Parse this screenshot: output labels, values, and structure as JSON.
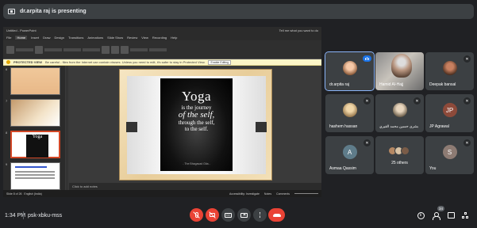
{
  "banner": {
    "presenter_text": "dr.arpita raj is presenting"
  },
  "presentation": {
    "window_title": "Untitled - PowerPoint",
    "ribbon_tabs": [
      "File",
      "Home",
      "Insert",
      "Draw",
      "Design",
      "Transitions",
      "Animations",
      "Slide Show",
      "Review",
      "View",
      "Recording",
      "Help"
    ],
    "tell_me": "Tell me what you want to do",
    "protected_view_label": "PROTECTED VIEW",
    "warning_text": "Be careful - files from the Internet can contain viruses. Unless you need to edit, it's safer to stay in Protected View.",
    "enable_button": "Enable Editing",
    "slide_numbers": [
      "6",
      "7",
      "8",
      "9"
    ],
    "slide": {
      "title": "Yoga",
      "line1": "is the journey",
      "line2": "of the self,",
      "line3": "through the self,",
      "line4": "to the self.",
      "attribution": "- The Bhagavad Gita -"
    },
    "notes_placeholder": "Click to add notes",
    "status_left": "Slide 8 of 26",
    "status_lang": "English (India)",
    "status_accessibility": "Accessibility: Investigate",
    "status_notes": "Notes",
    "status_comments": "Comments"
  },
  "participants": [
    {
      "name": "dr.arpita raj",
      "state": "speaking",
      "avatar": "photo"
    },
    {
      "name": "Hamid Al-Hajj",
      "state": "video",
      "avatar": "video"
    },
    {
      "name": "Deepak bansal",
      "state": "muted",
      "avatar": "photo"
    },
    {
      "name": "hashem hassan",
      "state": "muted",
      "avatar": "photo"
    },
    {
      "name": "بشرى حسين محمد القيري",
      "state": "muted",
      "avatar": "photo"
    },
    {
      "name": "JP Agrawal",
      "state": "muted",
      "avatar_initials": "JP",
      "avatar_color": "#8d4a3a"
    },
    {
      "name": "Asmaa Qassim",
      "state": "muted",
      "avatar_initials": "A",
      "avatar_color": "#5f7c8a"
    },
    {
      "name": "25 others",
      "state": "group"
    },
    {
      "name": "You",
      "state": "muted",
      "avatar_initials": "S",
      "avatar_color": "#8d7b73"
    }
  ],
  "bottom_bar": {
    "time": "1:34 PM",
    "meeting_code": "psk-xbku-mss",
    "participant_count": "34",
    "cc_label": "CC"
  },
  "colors": {
    "background": "#202124",
    "tile": "#3c4043",
    "end_call": "#ea4335",
    "accent": "#1a73e8"
  }
}
